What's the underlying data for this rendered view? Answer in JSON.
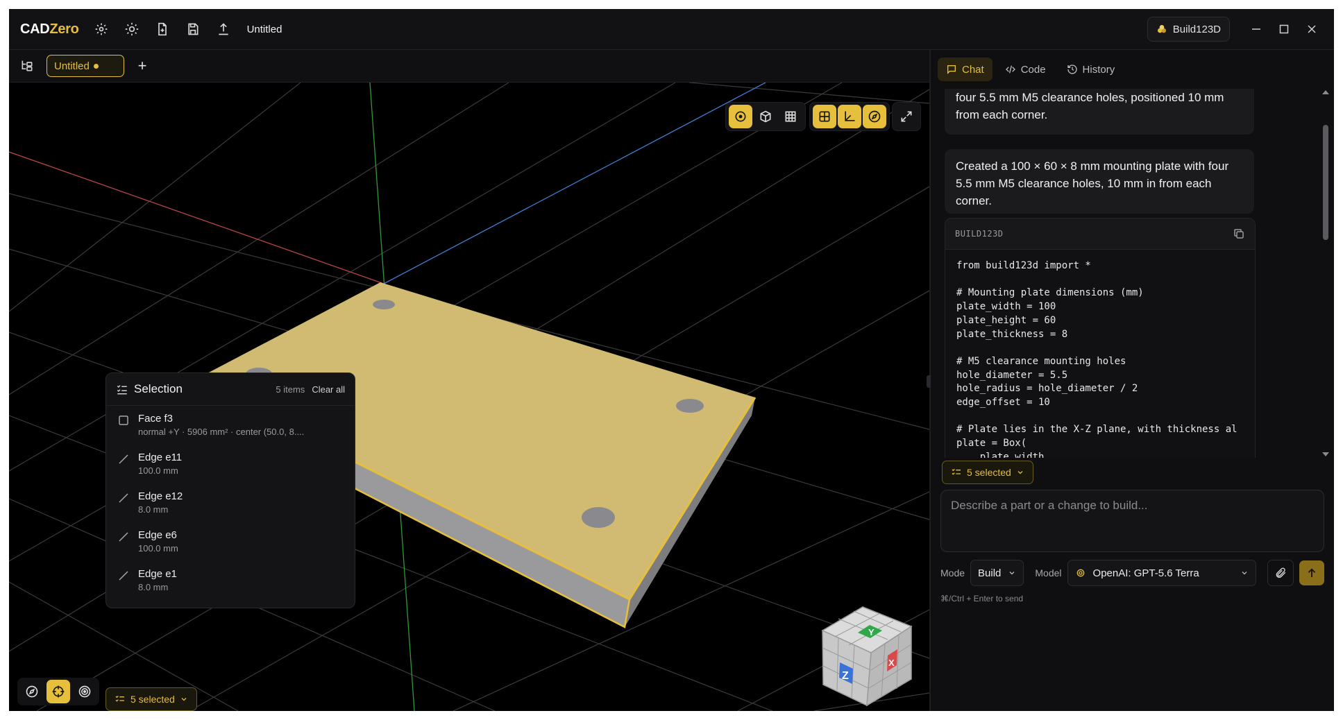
{
  "app": {
    "logo_primary": "CAD",
    "logo_accent": "Zero",
    "document_title": "Untitled",
    "kernel_badge": "Build123D",
    "accent_color": "#e6bf3c"
  },
  "tabs": [
    {
      "label": "Untitled",
      "unsaved": true
    }
  ],
  "viewport_toolbar": {
    "icons": [
      "target-icon",
      "cube-icon",
      "grid-icon",
      "quad-view-icon",
      "axes-icon",
      "compass-icon",
      "expand-icon"
    ]
  },
  "selection_panel": {
    "title": "Selection",
    "count": "5 items",
    "clear_label": "Clear all",
    "items": [
      {
        "name": "Face f3",
        "detail": "normal +Y · 5906 mm² · center (50.0, 8....",
        "kind": "face"
      },
      {
        "name": "Edge e11",
        "detail": "100.0 mm",
        "kind": "edge"
      },
      {
        "name": "Edge e12",
        "detail": "8.0 mm",
        "kind": "edge"
      },
      {
        "name": "Edge e6",
        "detail": "100.0 mm",
        "kind": "edge"
      },
      {
        "name": "Edge e1",
        "detail": "8.0 mm",
        "kind": "edge"
      }
    ]
  },
  "viewport_bottom": {
    "selected_chip": "5 selected"
  },
  "view_cube": {
    "labels": [
      "Y",
      "Z",
      "X"
    ]
  },
  "right_panel": {
    "tabs": [
      {
        "label": "Chat",
        "active": true
      },
      {
        "label": "Code",
        "active": false
      },
      {
        "label": "History",
        "active": false
      }
    ],
    "messages": [
      "four 5.5 mm M5 clearance holes, positioned 10 mm from each corner.",
      "Created a 100 × 60 × 8 mm mounting plate with four 5.5 mm M5 clearance holes, 10 mm in from each corner."
    ],
    "code_block": {
      "language": "BUILD123D",
      "code": "from build123d import *\n\n# Mounting plate dimensions (mm)\nplate_width = 100\nplate_height = 60\nplate_thickness = 8\n\n# M5 clearance mounting holes\nhole_diameter = 5.5\nhole_radius = hole_diameter / 2\nedge_offset = 10\n\n# Plate lies in the X-Z plane, with thickness al\nplate = Box(\n    plate_width,\n    plate_thickness,\n    plate_height,\n    align=(Align.MIN, Align.MIN, Align.MIN)"
    },
    "selected_chip": "5 selected",
    "input_placeholder": "Describe a part or a change to build...",
    "mode_label": "Mode",
    "mode_value": "Build",
    "model_label": "Model",
    "model_value": "OpenAI: GPT-5.6 Terra",
    "send_hint": "⌘/Ctrl + Enter to send"
  }
}
